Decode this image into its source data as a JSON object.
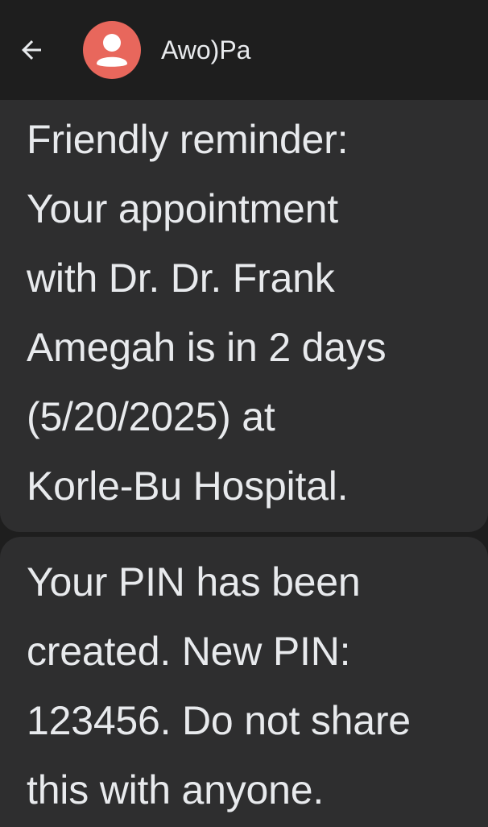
{
  "header": {
    "contact_name": "Awo)Pa",
    "back_icon": "arrow-left-icon",
    "avatar_icon": "person-icon",
    "avatar_color": "#e8675c"
  },
  "messages": [
    {
      "lines": [
        "Friendly reminder:",
        "Your appointment",
        "with Dr. Dr. Frank",
        "Amegah is in 2 days",
        "(5/20/2025) at",
        "Korle-Bu Hospital."
      ]
    },
    {
      "lines": [
        "Your PIN has been",
        "created. New PIN:",
        "123456. Do not share",
        "this with anyone."
      ]
    }
  ],
  "colors": {
    "background": "#1e1e1e",
    "bubble": "#2e2e2f",
    "text": "#e8eaed"
  }
}
